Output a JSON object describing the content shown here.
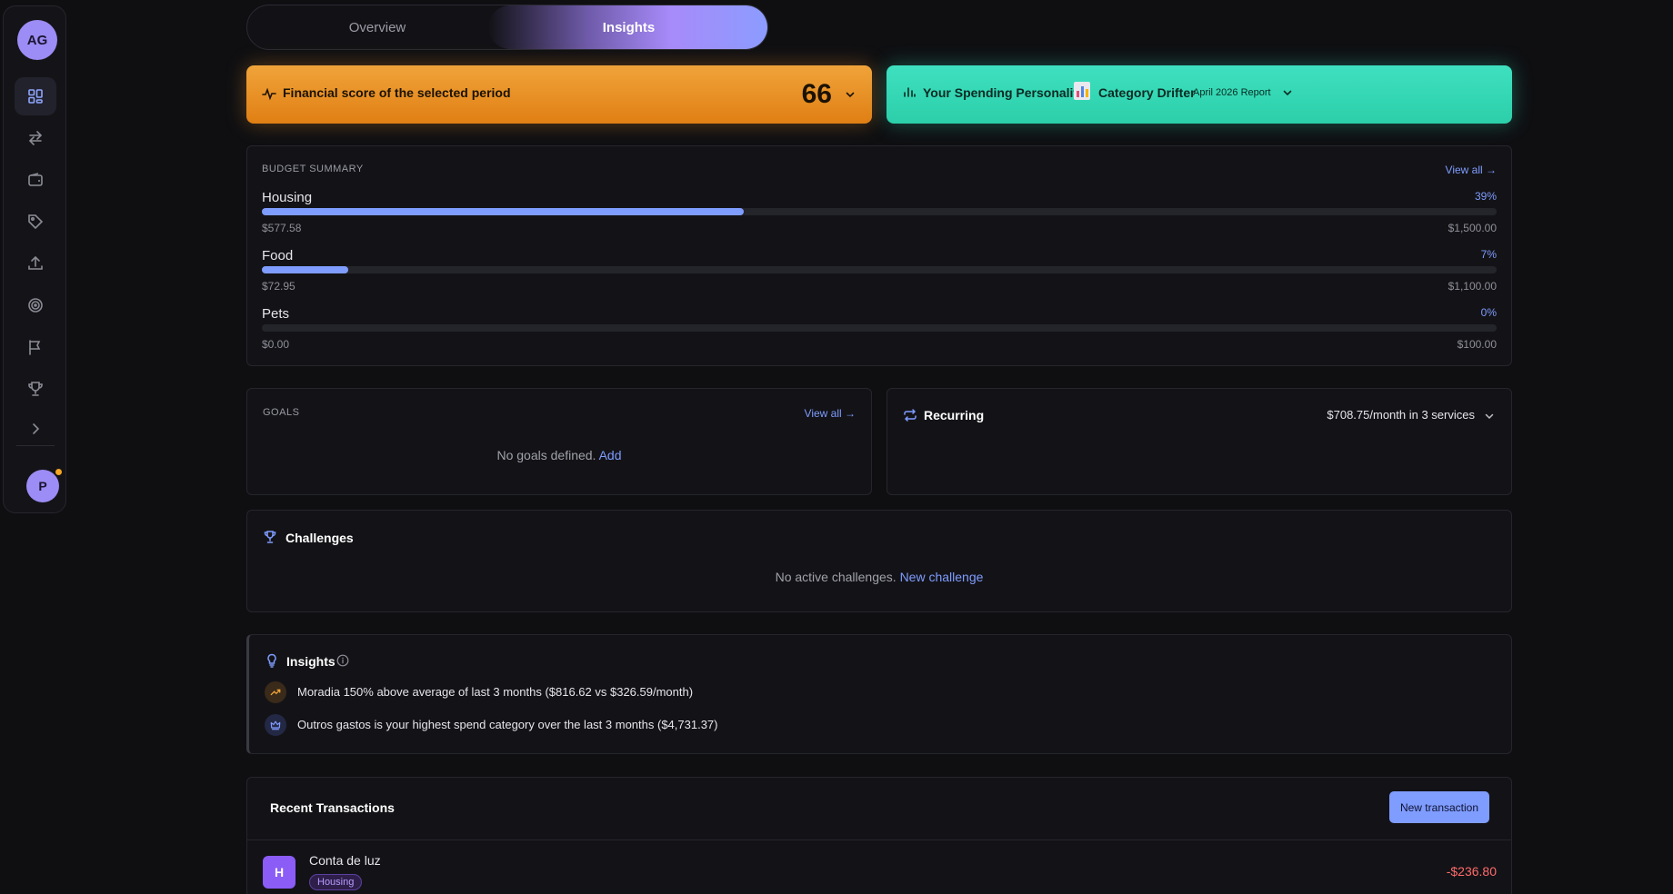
{
  "sidebar": {
    "avatar_initials": "AG",
    "items": [
      {
        "icon": "dashboard-icon",
        "active": true
      },
      {
        "icon": "transfer-arrows-icon",
        "active": false
      },
      {
        "icon": "wallet-icon",
        "active": false
      },
      {
        "icon": "tag-icon",
        "active": false
      },
      {
        "icon": "upload-icon",
        "active": false
      },
      {
        "icon": "target-icon",
        "active": false
      },
      {
        "icon": "flag-icon",
        "active": false
      },
      {
        "icon": "trophy-icon",
        "active": false
      }
    ],
    "expand_icon": "chevron-right-icon",
    "user_initial": "P",
    "notification_color": "#f5a623"
  },
  "tabs": {
    "overview": "Overview",
    "insights": "Insights",
    "active": "insights"
  },
  "score": {
    "label": "Financial score of the selected period",
    "value": "66",
    "color": "#e9921f"
  },
  "personality": {
    "label": "Your Spending Personality",
    "type": "Category Drifter",
    "report": "April 2026 Report",
    "color": "#34d6b4"
  },
  "budget": {
    "title": "BUDGET SUMMARY",
    "view_all": "View all →",
    "items": [
      {
        "name": "Housing",
        "percent": "39%",
        "fill": 0.39,
        "spent": "$577.58",
        "limit": "$1,500.00"
      },
      {
        "name": "Food",
        "percent": "7%",
        "fill": 0.07,
        "spent": "$72.95",
        "limit": "$1,100.00"
      },
      {
        "name": "Pets",
        "percent": "0%",
        "fill": 0.0,
        "spent": "$0.00",
        "limit": "$100.00"
      }
    ]
  },
  "goals": {
    "title": "GOALS",
    "view_all": "View all →",
    "empty_text": "No goals defined.",
    "add_label": "Add"
  },
  "recurring": {
    "title": "Recurring",
    "summary": "$708.75/month in 3 services"
  },
  "challenges": {
    "title": "Challenges",
    "empty_text": "No active challenges.",
    "new_label": "New challenge"
  },
  "insights": {
    "title": "Insights",
    "items": [
      {
        "icon": "trending-up-icon",
        "text": "Moradia 150% above average of last 3 months ($816.62 vs $326.59/month)"
      },
      {
        "icon": "crown-icon",
        "text": "Outros gastos is your highest spend category over the last 3 months ($4,731.37)"
      }
    ]
  },
  "transactions": {
    "title": "Recent Transactions",
    "new_label": "New transaction",
    "items": [
      {
        "initial": "H",
        "name": "Conta de luz",
        "category": "Housing",
        "amount": "-$236.80"
      }
    ]
  },
  "accent_color": "#7f9cff"
}
